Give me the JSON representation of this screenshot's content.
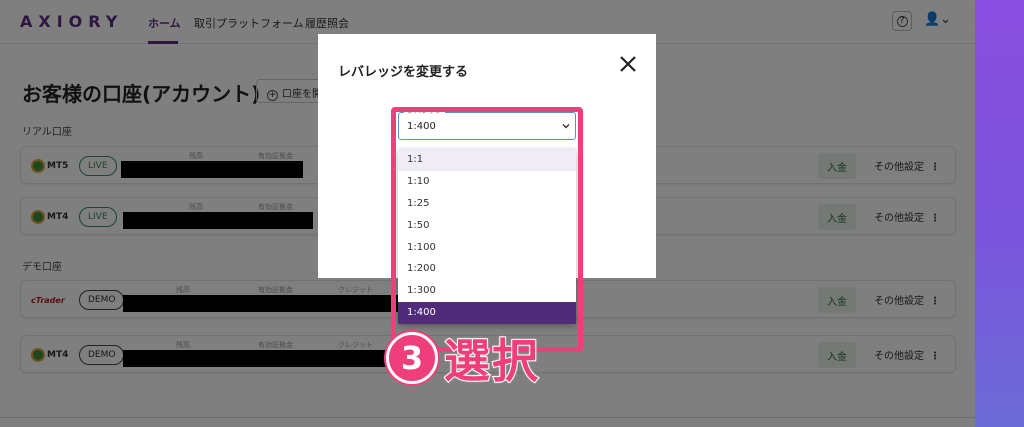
{
  "header": {
    "logo": "AXIORY",
    "nav": [
      "ホーム",
      "取引プラットフォーム",
      "履歴照会"
    ],
    "help_icon": "?",
    "user_icon": "👤⌄"
  },
  "main": {
    "title": "お客様の口座(アカウント)",
    "add_account_label": "口座を開",
    "real_section": "リアル口座",
    "demo_section": "デモ口座",
    "column_labels": {
      "balance": "残高",
      "equity": "有効証拠金",
      "credit": "クレジット"
    },
    "accounts": [
      {
        "platform": "MT5",
        "type": "LIVE",
        "deposit": "入金",
        "settings": "その他設定"
      },
      {
        "platform": "MT4",
        "type": "LIVE",
        "deposit": "入金",
        "settings": "その他設定"
      },
      {
        "platform": "cTrader",
        "type": "DEMO",
        "deposit": "入金",
        "settings": "その他設定"
      },
      {
        "platform": "MT4",
        "type": "DEMO",
        "deposit": "入金",
        "settings": "その他設定"
      }
    ]
  },
  "modal": {
    "title": "レバレッジを変更する",
    "select_label": "レバレッジ",
    "selected_value": "1:400",
    "options": [
      "1:1",
      "1:10",
      "1:25",
      "1:50",
      "1:100",
      "1:200",
      "1:300",
      "1:400"
    ]
  },
  "annotation": {
    "number": "3",
    "text": "選択"
  },
  "colors": {
    "brand_purple": "#5a2d82",
    "highlight_pink": "#ee3f7c",
    "selected_option": "#4f2b7a"
  }
}
